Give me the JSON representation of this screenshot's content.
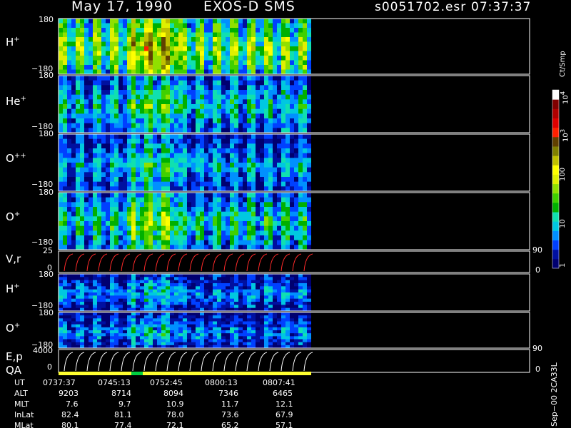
{
  "header": {
    "date": "May 17, 1990",
    "instrument": "EXOS-D SMS",
    "file": "s0051702.esr",
    "time": "07:37:37"
  },
  "colors": {
    "background": "#000000",
    "frame": "#ffffff",
    "velocity_trace": "#ff2a2a",
    "qa_good": "#ffff30",
    "qa_flag": "#00d040"
  },
  "panels": [
    {
      "id": "h1",
      "label": "H",
      "sup": "+",
      "ytop": "180",
      "ybot": "−180",
      "kind": "spectrogram",
      "intensity": 0.55,
      "right_label": ""
    },
    {
      "id": "he1",
      "label": "He",
      "sup": "+",
      "ytop": "180",
      "ybot": "−180",
      "kind": "spectrogram",
      "intensity": 0.35,
      "right_label": ""
    },
    {
      "id": "opp",
      "label": "O",
      "sup": "++",
      "ytop": "180",
      "ybot": "−180",
      "kind": "spectrogram",
      "intensity": 0.3,
      "right_label": ""
    },
    {
      "id": "o1",
      "label": "O",
      "sup": "+",
      "ytop": "180",
      "ybot": "−180",
      "kind": "spectrogram",
      "intensity": 0.4,
      "right_label": ""
    },
    {
      "id": "vr",
      "label": "V,r",
      "sup": "",
      "ytop": "25",
      "ybot": "0",
      "kind": "line",
      "right_top": "90",
      "right_bot": "0"
    },
    {
      "id": "h2",
      "label": "H",
      "sup": "+",
      "ytop": "180",
      "ybot": "−180",
      "kind": "spectrogram",
      "intensity": 0.25,
      "right_label": ""
    },
    {
      "id": "o2",
      "label": "O",
      "sup": "+",
      "ytop": "180",
      "ybot": "−180",
      "kind": "spectrogram",
      "intensity": 0.25,
      "right_label": ""
    },
    {
      "id": "ep",
      "label": "E,p",
      "sup": "",
      "ytop": "4000",
      "ybot": "0",
      "kind": "line",
      "right_top": "90",
      "right_bot": "0",
      "label2": "QA"
    }
  ],
  "colorbar": {
    "unit": "Ct/Smp",
    "ticks": [
      {
        "label": "1",
        "value": 1
      },
      {
        "label": "10",
        "value": 10
      },
      {
        "label": "100",
        "value": 100
      },
      {
        "label": "10",
        "sup": "3",
        "value": 1000
      },
      {
        "label": "10",
        "sup": "4",
        "value": 10000
      }
    ],
    "colors": [
      "#000070",
      "#0010a0",
      "#0040ff",
      "#0090ff",
      "#00c8e0",
      "#10e0b0",
      "#00b000",
      "#40d000",
      "#90e000",
      "#e0f000",
      "#ffff00",
      "#c0c000",
      "#808000",
      "#604000",
      "#ff2000",
      "#e00000",
      "#b00000",
      "#800000",
      "#ffffff"
    ]
  },
  "footer": {
    "labels": [
      "UT",
      "ALT",
      "MLT",
      "InLat",
      "MLat"
    ],
    "columns": [
      [
        "0737:37",
        "9203",
        "7.6",
        "82.4",
        "80.1"
      ],
      [
        "0745:13",
        "8714",
        "9.7",
        "81.1",
        "77.4"
      ],
      [
        "0752:45",
        "8094",
        "10.9",
        "78.0",
        "72.1"
      ],
      [
        "0800:13",
        "7346",
        "11.7",
        "73.6",
        "65.2"
      ],
      [
        "0807:41",
        "6465",
        "12.1",
        "67.9",
        "57.1"
      ]
    ],
    "stamp": "Sep−00  2CA33L"
  },
  "chart_data": {
    "type": "heatmap",
    "title": "May 17, 1990   EXOS-D SMS",
    "x": [
      "0737:37",
      "0745:13",
      "0752:45",
      "0800:13",
      "0807:41"
    ],
    "colorscale": "log",
    "zlim": [
      1,
      10000
    ],
    "zlabel": "Ct/Smp",
    "series": [
      {
        "name": "H+",
        "ylim": [
          -180,
          180
        ]
      },
      {
        "name": "He+",
        "ylim": [
          -180,
          180
        ]
      },
      {
        "name": "O++",
        "ylim": [
          -180,
          180
        ]
      },
      {
        "name": "O+",
        "ylim": [
          -180,
          180
        ]
      },
      {
        "name": "V,r",
        "ylim": [
          0,
          25
        ]
      },
      {
        "name": "H+",
        "ylim": [
          -180,
          180
        ]
      },
      {
        "name": "O+",
        "ylim": [
          -180,
          180
        ]
      },
      {
        "name": "E,p",
        "ylim": [
          0,
          4000
        ]
      }
    ]
  }
}
